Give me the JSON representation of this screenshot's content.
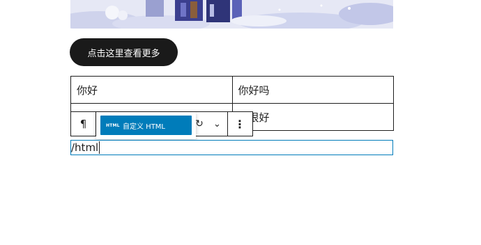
{
  "image": {
    "alt": ""
  },
  "button": {
    "label": "点击这里查看更多"
  },
  "table": {
    "rows": [
      [
        "你好",
        "你好吗"
      ],
      [
        "",
        "我很好"
      ]
    ]
  },
  "toolbar": {
    "paragraph_icon": "¶",
    "transform_icon": "↻",
    "chevron_icon": "⌄",
    "more_icon": "⋮"
  },
  "inserter": {
    "icon_text": "HTML",
    "label": "自定义 HTML",
    "highlight_color": "#007cba"
  },
  "slash_input": {
    "value": "/html"
  }
}
